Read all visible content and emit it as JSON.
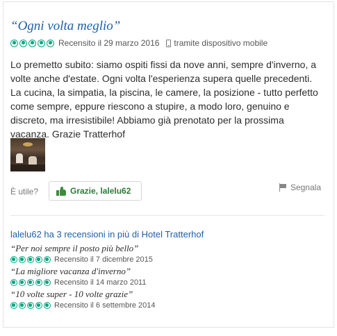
{
  "review": {
    "title": "“Ogni volta meglio”",
    "rating": 5,
    "date": "Recensito il 29 marzo 2016",
    "device": "tramite dispositivo mobile",
    "body": "Lo premetto subito: siamo ospiti fissi da nove anni, sempre d'inverno, a volte anche d'estate. Ogni volta l'esperienza supera quelle precedenti. La cucina, la simpatia, la piscina, le camere, la posizione - tutto perfetto come sempre, eppure riescono a stupire, a modo loro, genuino e discreto, ma irresistibile! Abbiamo già prenotato per la prossima vacanza. Grazie Tratterhof",
    "helpful_label": "È utile?",
    "thanks_button": "Grazie, lalelu62",
    "report_label": "Segnala"
  },
  "more_reviews": {
    "heading": "lalelu62 ha 3 recensioni in più di Hotel Tratterhof",
    "items": [
      {
        "title": "“Per noi sempre il posto più bello”",
        "rating": 5,
        "date": "Recensito il 7 dicembre 2015"
      },
      {
        "title": "“La migliore vacanza d'inverno”",
        "rating": 5,
        "date": "Recensito il 14 marzo 2011"
      },
      {
        "title": "“10 volte super - 10 volte grazie”",
        "rating": 5,
        "date": "Recensito il 6 settembre 2014"
      }
    ]
  },
  "colors": {
    "title_link": "#1f5fa5",
    "rating_green": "#00a680",
    "thanks_green": "#2b7a38"
  },
  "icons": {
    "rating": "bubble-rating-icon",
    "device": "mobile-phone-icon",
    "thanks": "thumbs-up-icon",
    "report": "flag-icon"
  }
}
